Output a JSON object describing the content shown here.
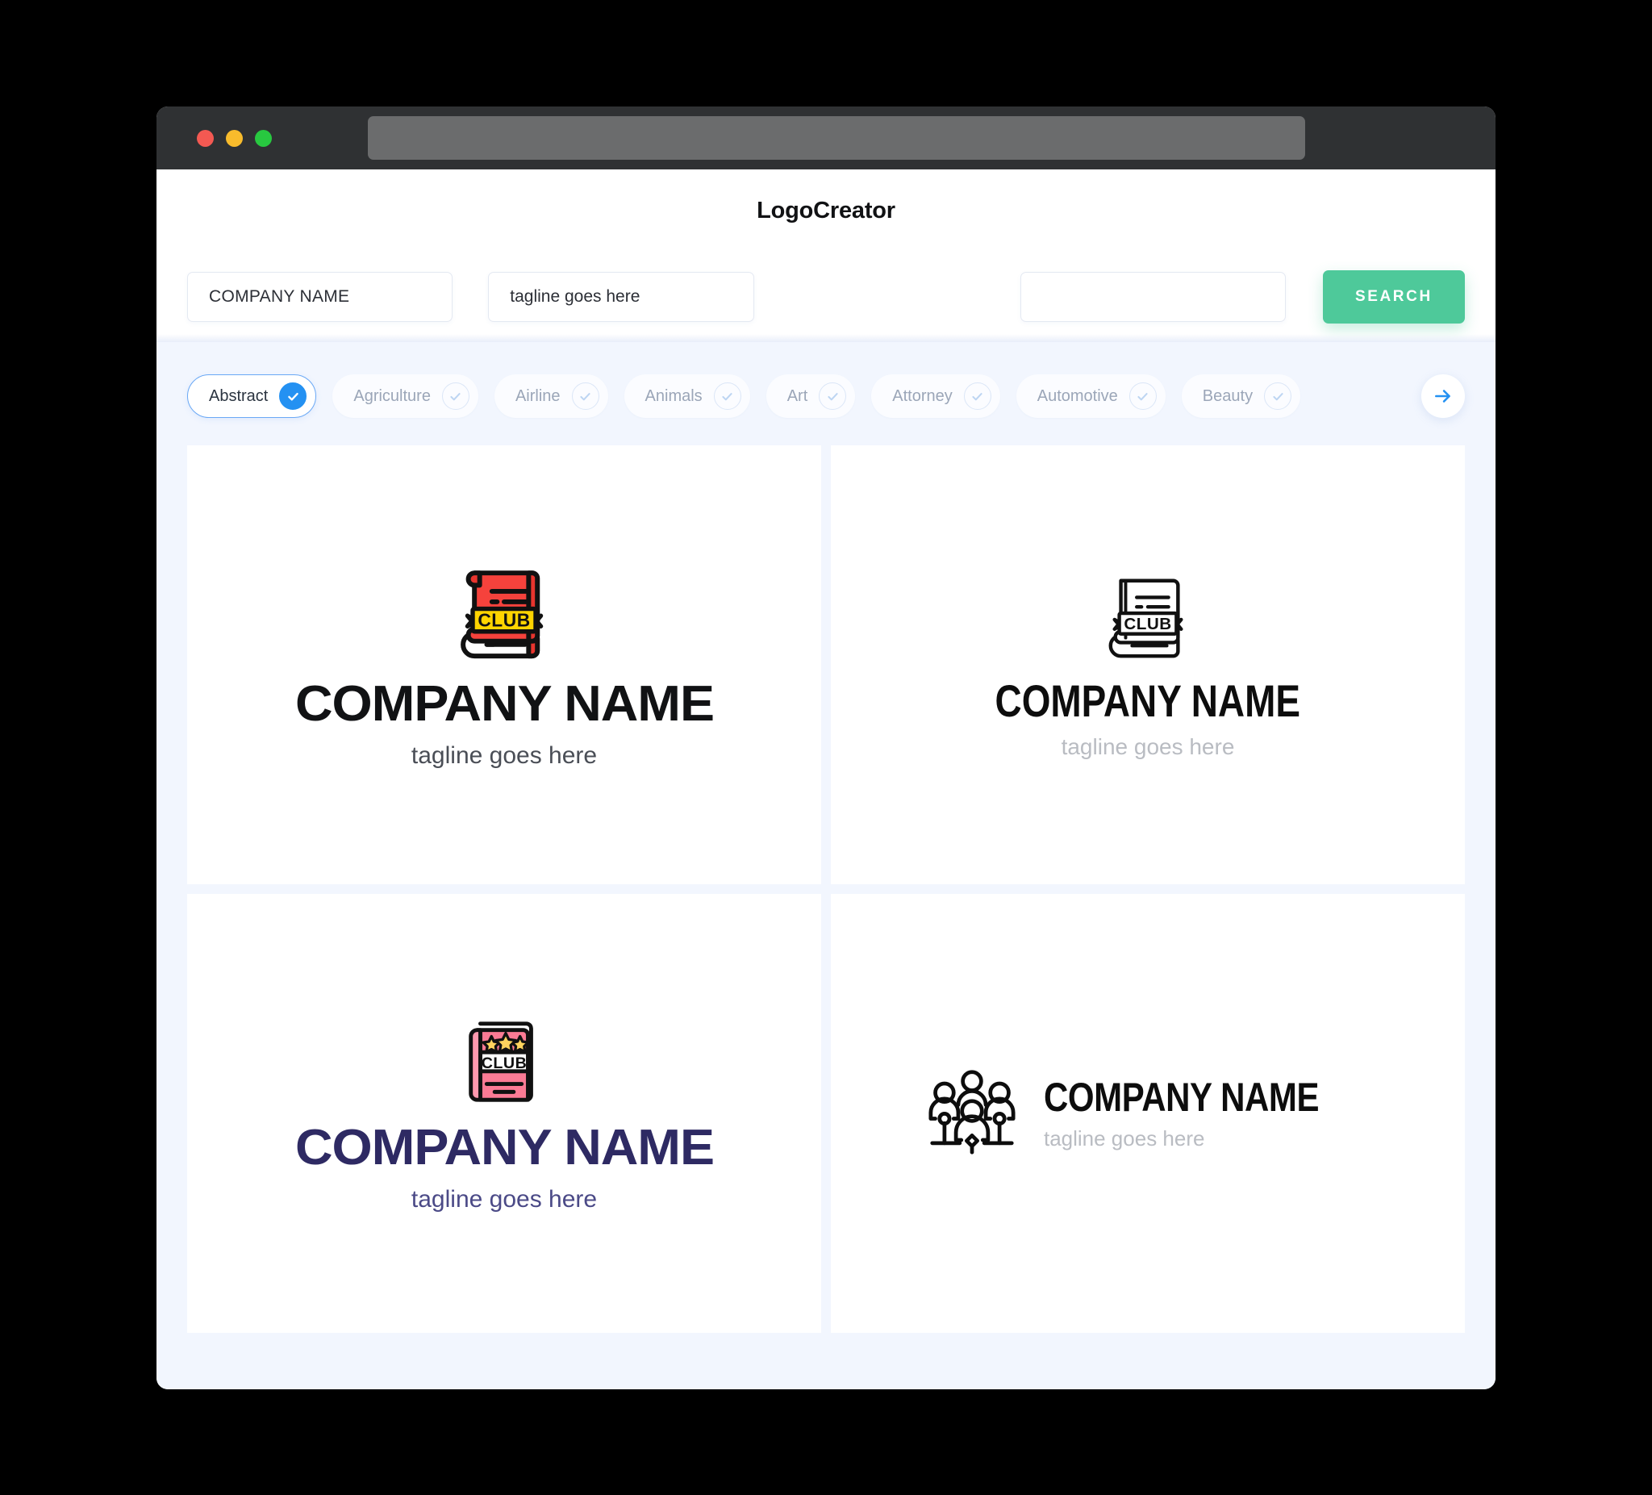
{
  "window": {
    "traffic_lights": [
      "close",
      "minimize",
      "zoom"
    ],
    "url_value": ""
  },
  "header": {
    "title": "LogoCreator"
  },
  "search": {
    "company_value": "COMPANY NAME",
    "tagline_value": "tagline goes here",
    "extra_value": "",
    "button_label": "SEARCH",
    "button_color": "#4EC99A"
  },
  "categories": {
    "selected": "Abstract",
    "accent_color": "#2491F2",
    "items": [
      {
        "label": "Abstract",
        "selected": true
      },
      {
        "label": "Agriculture",
        "selected": false
      },
      {
        "label": "Airline",
        "selected": false
      },
      {
        "label": "Animals",
        "selected": false
      },
      {
        "label": "Art",
        "selected": false
      },
      {
        "label": "Attorney",
        "selected": false
      },
      {
        "label": "Automotive",
        "selected": false
      },
      {
        "label": "Beauty",
        "selected": false
      }
    ],
    "next_icon": "arrow-right-icon"
  },
  "results": [
    {
      "icon": "club-book-ribbon-color-icon",
      "name": "COMPANY NAME",
      "tagline": "tagline goes here",
      "name_color": "#111214",
      "tagline_color": "#4A4E56",
      "badge_text": "CLUB"
    },
    {
      "icon": "club-book-ribbon-outline-icon",
      "name": "COMPANY NAME",
      "tagline": "tagline goes here",
      "name_color": "#0D0D0D",
      "tagline_color": "#B9BCC2",
      "badge_text": "CLUB"
    },
    {
      "icon": "club-book-stars-pink-icon",
      "name": "COMPANY NAME",
      "tagline": "tagline goes here",
      "name_color": "#2E2A63",
      "tagline_color": "#4B4A87",
      "badge_text": "CLUB"
    },
    {
      "icon": "people-group-outline-icon",
      "name": "COMPANY NAME",
      "tagline": "tagline goes here",
      "name_color": "#0D0D0D",
      "tagline_color": "#B9BCC2",
      "badge_text": ""
    }
  ]
}
